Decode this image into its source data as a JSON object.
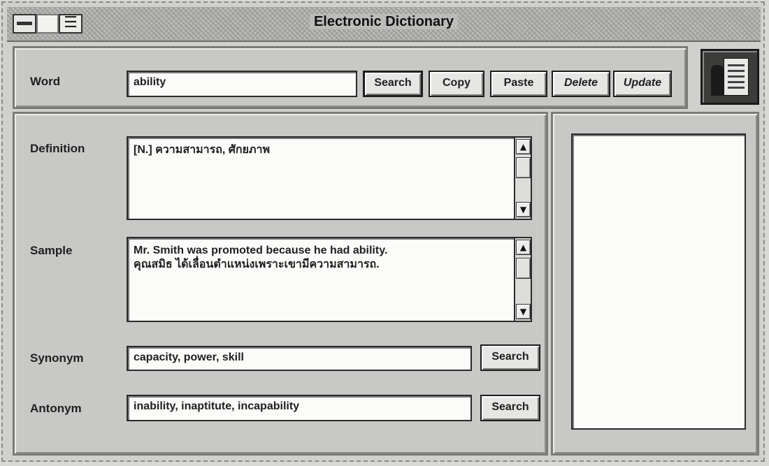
{
  "window": {
    "title": "Electronic Dictionary"
  },
  "titlebar": {
    "menu_glyph": "☰"
  },
  "word": {
    "label": "Word",
    "value": "ability",
    "buttons": {
      "search": "Search",
      "copy": "Copy",
      "paste": "Paste",
      "delete": "Delete",
      "update": "Update"
    }
  },
  "definition": {
    "label": "Definition",
    "value": "[N.] ความสามารถ, ศักยภาพ"
  },
  "sample": {
    "label": "Sample",
    "value": "Mr. Smith was promoted because he had ability.\nคุณสมิธ ได้เลื่อนตำแหน่งเพราะเขามีความสามารถ."
  },
  "synonym": {
    "label": "Synonym",
    "value": "capacity, power, skill",
    "search_label": "Search"
  },
  "antonym": {
    "label": "Antonym",
    "value": "inability, inaptitute, incapability",
    "search_label": "Search"
  },
  "scroll": {
    "up": "▲",
    "down": "▼"
  },
  "side_list": {
    "items": []
  }
}
